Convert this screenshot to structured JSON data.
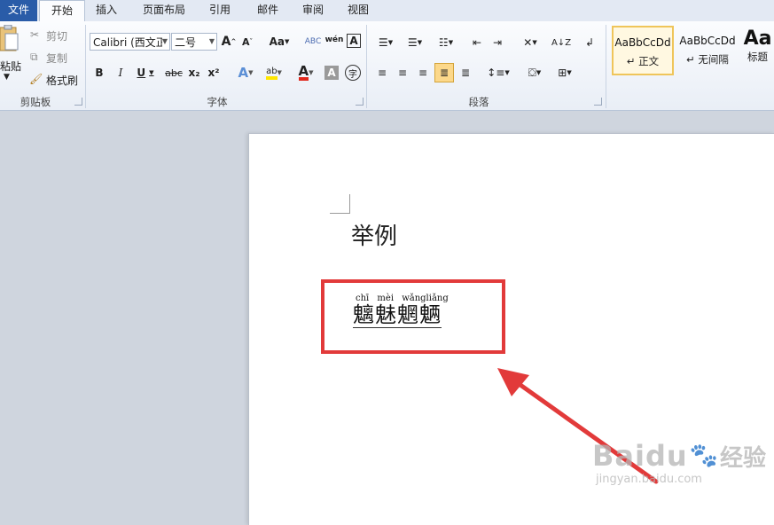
{
  "tabs": [
    "文件",
    "开始",
    "插入",
    "页面布局",
    "引用",
    "邮件",
    "审阅",
    "视图"
  ],
  "clipboard": {
    "paste": "粘贴",
    "cut": "剪切",
    "copy": "复制",
    "format_painter": "格式刷",
    "group": "剪贴板"
  },
  "font": {
    "name": "Calibri (西文正",
    "size": "二号",
    "group": "字体",
    "bold": "B",
    "italic": "I",
    "underline": "U",
    "strike": "abc",
    "sub": "x₂",
    "sup": "x²",
    "grow": "A",
    "shrink": "A",
    "case": "Aa",
    "color": "A",
    "clear": "A",
    "phonetic": "wén",
    "border": "A",
    "enclose": "字"
  },
  "paragraph": {
    "group": "段落"
  },
  "styles": [
    {
      "sample": "AaBbCcDd",
      "name": "↵ 正文"
    },
    {
      "sample": "AaBbCcDd",
      "name": "↵ 无间隔"
    },
    {
      "sample": "Aa",
      "name": "标题"
    }
  ],
  "document": {
    "heading": "举例",
    "pinyin": "chī mèi wǎngliǎng",
    "chars": "魑魅魍魉"
  },
  "watermark": {
    "brand": "Baidu",
    "sub": "经验",
    "url": "jingyan.baidu.com"
  },
  "colors": {
    "accent": "#2a5ca8",
    "annotation": "#e23a3a"
  }
}
